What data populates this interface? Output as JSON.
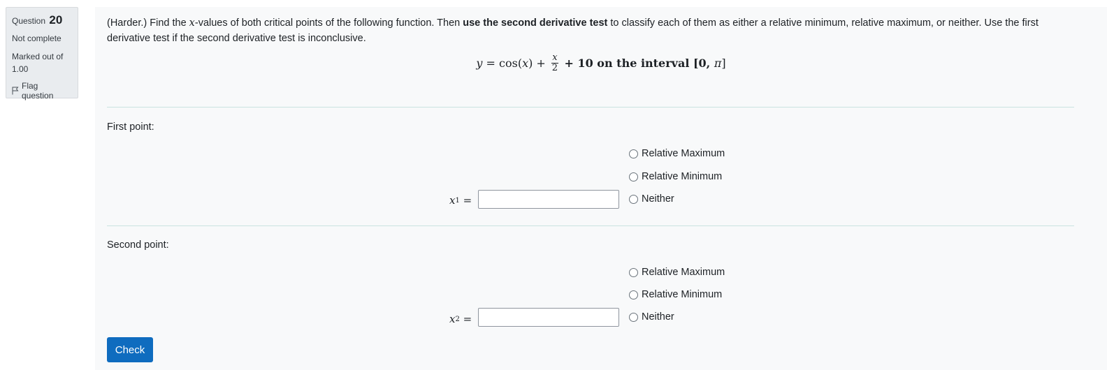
{
  "question_info": {
    "question_label": "Question",
    "question_number": "20",
    "state": "Not complete",
    "grade_line1": "Marked out of",
    "grade_line2": "1.00",
    "flag_label": "Flag question"
  },
  "question": {
    "text_part1": "(Harder.) Find the ",
    "text_var": "x",
    "text_part2": "-values of both critical points of the following function. Then ",
    "text_bold": "use the second derivative test",
    "text_part3": " to classify each of them as either a relative minimum, relative maximum, or neither. Use the first derivative test if the second derivative test is inconclusive.",
    "formula": {
      "lhs": "y",
      "eq": " = cos(",
      "arg": "x",
      "close": ") + ",
      "frac_num": "x",
      "frac_den": "2",
      "tail": " + 10 on the interval [0, ",
      "pi": "π",
      "end": "]"
    }
  },
  "first_point": {
    "label": "First point:",
    "var_label": "x",
    "var_sub": "1",
    "eq": " =",
    "input_value": "",
    "options": [
      "Relative Maximum",
      "Relative Minimum",
      "Neither"
    ]
  },
  "second_point": {
    "label": "Second point:",
    "var_label": "x",
    "var_sub": "2",
    "eq": " =",
    "input_value": "",
    "options": [
      "Relative Maximum",
      "Relative Minimum",
      "Neither"
    ]
  },
  "check_button": {
    "label": "Check"
  },
  "colors": {
    "primary": "#0f6cbf",
    "info_bg": "#e9ecef",
    "content_bg": "#f8f9fa",
    "divider": "#c9e2e0"
  }
}
